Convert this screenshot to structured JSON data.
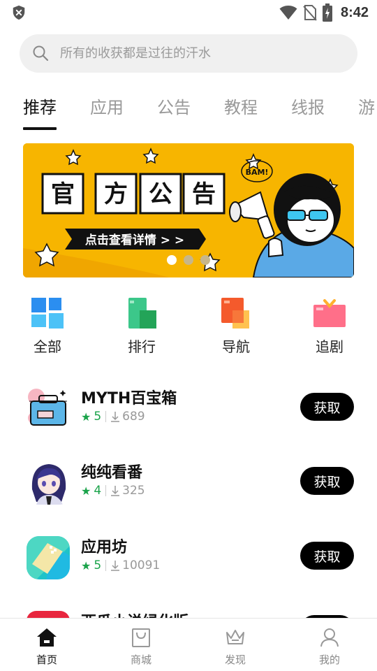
{
  "status": {
    "time": "8:42"
  },
  "search": {
    "placeholder": "所有的收获都是过往的汗水"
  },
  "tabs": [
    {
      "label": "推荐",
      "active": true
    },
    {
      "label": "应用",
      "active": false
    },
    {
      "label": "公告",
      "active": false
    },
    {
      "label": "教程",
      "active": false
    },
    {
      "label": "线报",
      "active": false
    },
    {
      "label": "游",
      "active": false
    }
  ],
  "banner": {
    "title_chars": [
      "官",
      "方",
      "公",
      "告"
    ],
    "button": "点击查看详情 > >",
    "bubble": "BAM!",
    "slides": 3,
    "active_slide": 0
  },
  "quick": [
    {
      "label": "全部",
      "icon": "grid-icon"
    },
    {
      "label": "排行",
      "icon": "ranking-icon"
    },
    {
      "label": "导航",
      "icon": "navigation-icon"
    },
    {
      "label": "追剧",
      "icon": "tv-icon"
    }
  ],
  "apps": [
    {
      "name": "MYTH百宝箱",
      "rating": "5",
      "downloads": "689",
      "action": "获取"
    },
    {
      "name": "纯纯看番",
      "rating": "4",
      "downloads": "325",
      "action": "获取"
    },
    {
      "name": "应用坊",
      "rating": "5",
      "downloads": "10091",
      "action": "获取"
    },
    {
      "name": "西瓜小说绿化版",
      "rating": "",
      "downloads": "",
      "action": ""
    }
  ],
  "nav": [
    {
      "label": "首页",
      "active": true
    },
    {
      "label": "商城",
      "active": false
    },
    {
      "label": "发现",
      "active": false
    },
    {
      "label": "我的",
      "active": false
    }
  ],
  "colors": {
    "accent": "#000000",
    "star": "#1aa34a",
    "banner_bg": "#f7b500"
  }
}
